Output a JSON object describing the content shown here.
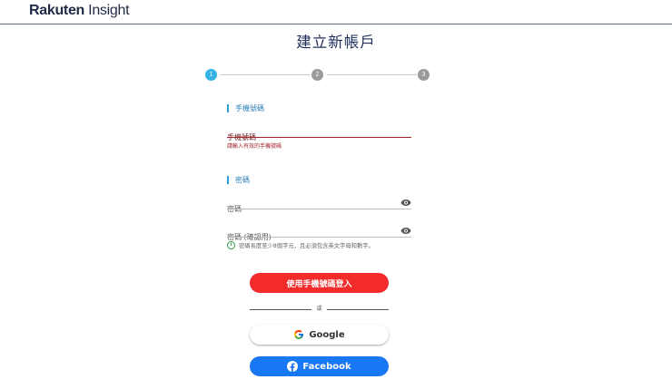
{
  "header": {
    "logo_brand": "Rakuten",
    "logo_product": " Insight",
    "border_color": "#5a6b86"
  },
  "page": {
    "title": "建立新帳戶"
  },
  "stepper": {
    "steps": [
      {
        "label": "1",
        "state": "active"
      },
      {
        "label": "2",
        "state": "inactive"
      },
      {
        "label": "3",
        "state": "inactive"
      }
    ],
    "active_color": "#33b4e4",
    "inactive_color": "#9a9a9a"
  },
  "phone_section": {
    "label": "手機號碼",
    "field_label": "手機號碼",
    "error": "請輸入有效的手機號碼"
  },
  "password_section": {
    "label": "密碼",
    "password_label": "密碼",
    "confirm_label": "密碼 (確認用)",
    "eye_icon": "eye-icon",
    "hint": "密碼長度至少8個字元，且必須包含英文字母和數字。",
    "hint_icon_glyph": "i"
  },
  "buttons": {
    "phone_login": "使用手機號碼登入",
    "or": "或",
    "google": "Google",
    "facebook": "Facebook",
    "phone_color": "#f42b2b",
    "facebook_color": "#1877f2"
  }
}
